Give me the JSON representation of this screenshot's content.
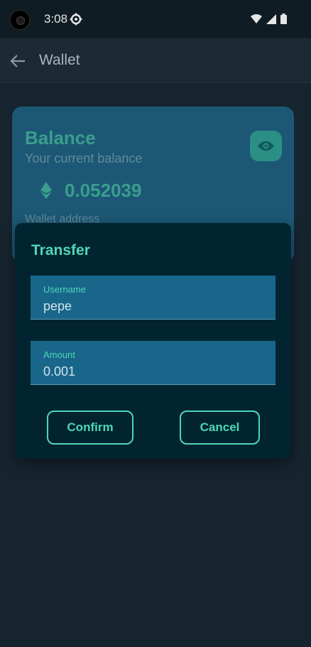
{
  "status_bar": {
    "time": "3:08"
  },
  "app_bar": {
    "title": "Wallet"
  },
  "balance_card": {
    "title": "Balance",
    "subtitle": "Your current balance",
    "amount": "0.052039",
    "wallet_label": "Wallet address"
  },
  "dialog": {
    "title": "Transfer",
    "fields": [
      {
        "label": "Username",
        "value": "pepe"
      },
      {
        "label": "Amount",
        "value": "0.001"
      }
    ],
    "confirm_label": "Confirm",
    "cancel_label": "Cancel"
  },
  "icons": {
    "camera": "camera-cutout-icon",
    "settings": "gear-icon",
    "wifi": "wifi-icon",
    "signal": "signal-icon",
    "battery": "battery-icon",
    "back": "back-arrow-icon",
    "visibility": "eye-icon",
    "currency": "ethereum-icon"
  },
  "colors": {
    "accent": "#4fd6b6",
    "card": "#1c5875",
    "dialog": "#022431",
    "field": "#18668a"
  }
}
